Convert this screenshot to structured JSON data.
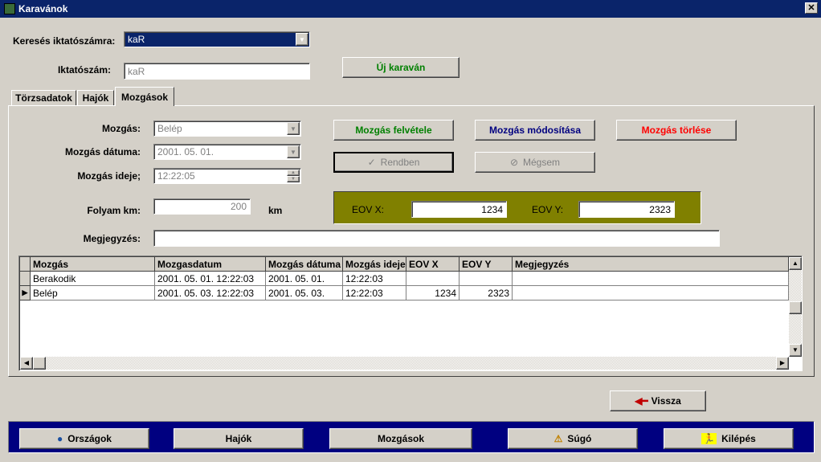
{
  "window": {
    "title": "Karavánok"
  },
  "search": {
    "label": "Keresés iktatószámra:",
    "value": "kaR"
  },
  "iktato": {
    "label": "Iktatószám:",
    "value": "kaR"
  },
  "new_button": "Új karaván",
  "tabs": [
    {
      "label": "Törzsadatok"
    },
    {
      "label": "Hajók"
    },
    {
      "label": "Mozgások",
      "active": true
    }
  ],
  "form": {
    "mozgas_label": "Mozgás:",
    "mozgas_value": "Belép",
    "datum_label": "Mozgás dátuma:",
    "datum_value": "2001. 05. 01.",
    "ido_label": "Mozgás ideje;",
    "ido_value": "12:22:05",
    "km_label": "Folyam km:",
    "km_value": "200",
    "km_unit": "km",
    "megj_label": "Megjegyzés:",
    "megj_value": ""
  },
  "actions": {
    "felvetel": "Mozgás felvétele",
    "modositas": "Mozgás módosítása",
    "torles": "Mozgás törlése",
    "rendben": "Rendben",
    "megsem": "Mégsem"
  },
  "eov": {
    "x_label": "EOV X:",
    "x_value": "1234",
    "y_label": "EOV Y:",
    "y_value": "2323"
  },
  "grid": {
    "headers": [
      "Mozgás",
      "Mozgasdatum",
      "Mozgás dátuma",
      "Mozgás ideje",
      "EOV X",
      "EOV Y",
      "Megjegyzés"
    ],
    "rows": [
      [
        "Berakodik",
        "2001. 05. 01. 12:22:03",
        "2001. 05. 01.",
        "12:22:03",
        "",
        "",
        ""
      ],
      [
        "Belép",
        "2001. 05. 03. 12:22:03",
        "2001. 05. 03.",
        "12:22:03",
        "1234",
        "2323",
        ""
      ]
    ]
  },
  "vissza": "Vissza",
  "bottom": [
    "Országok",
    "Hajók",
    "Mozgások",
    "Súgó",
    "Kilépés"
  ],
  "colors": {
    "green": "#008000",
    "navy": "#000080",
    "red": "#ff0000",
    "eov_bg": "#808000"
  }
}
